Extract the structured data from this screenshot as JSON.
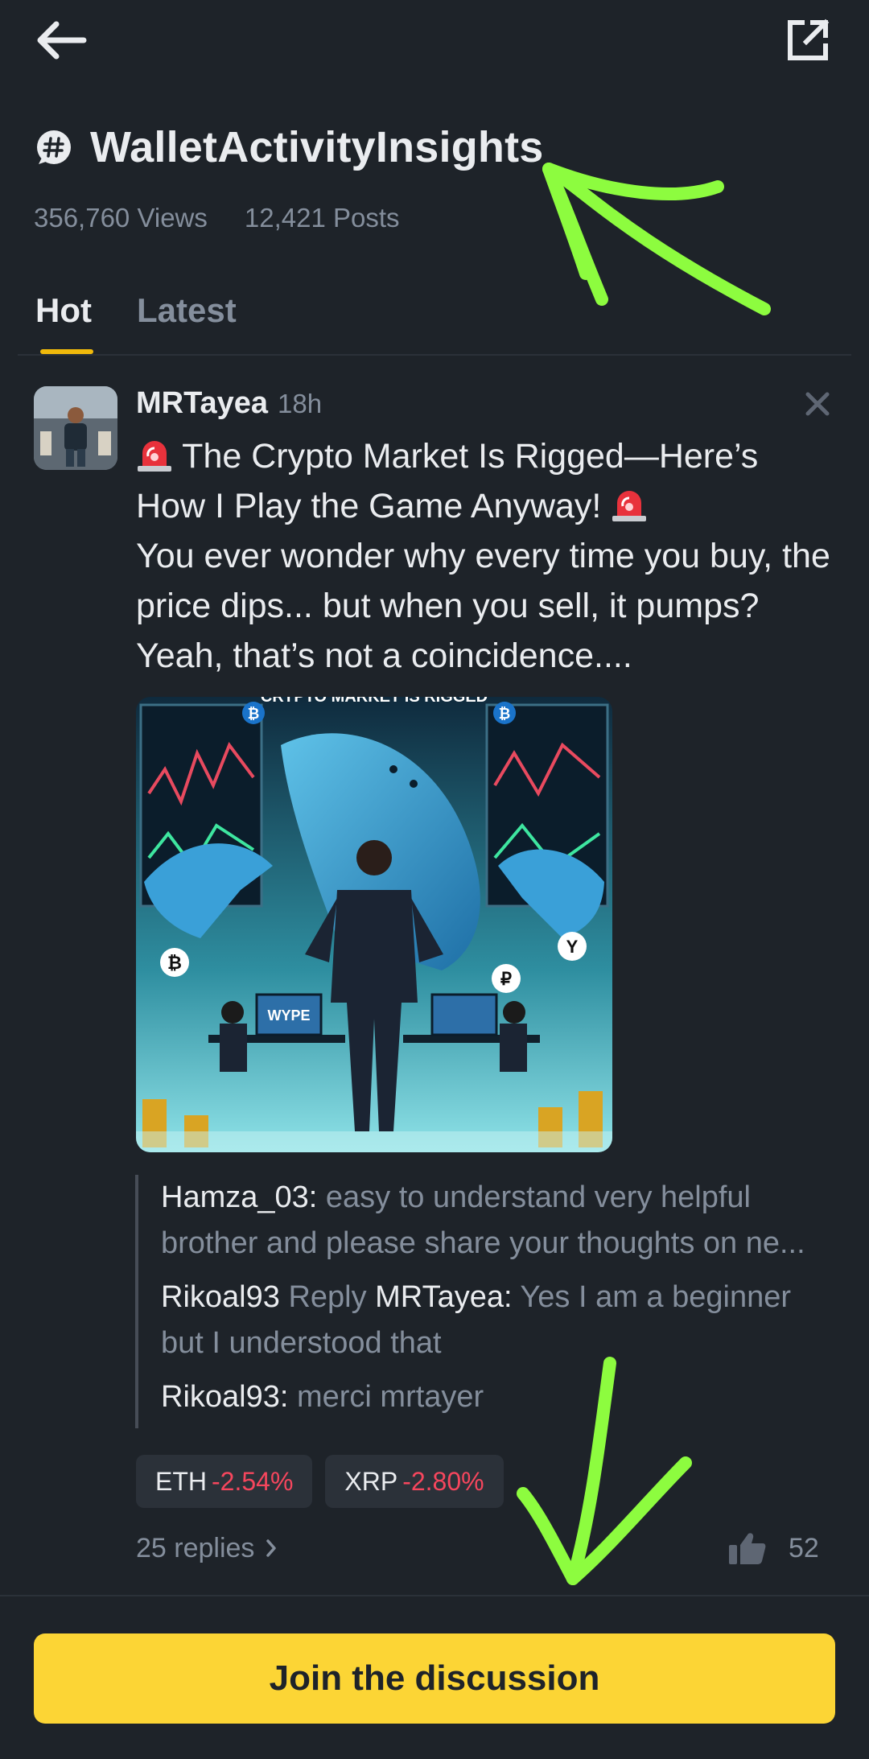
{
  "header": {
    "title": "WalletActivityInsights",
    "views": "356,760 Views",
    "posts": "12,421 Posts"
  },
  "tabs": [
    {
      "label": "Hot",
      "active": true
    },
    {
      "label": "Latest",
      "active": false
    }
  ],
  "post": {
    "author": "MRTayea",
    "time": "18h",
    "headline": "The Crypto Market Is Rigged—Here’s How I Play the Game Anyway!",
    "body": "You ever wonder why every time you buy, the price dips... but when you sell, it pumps? Yeah, that’s not a coincidence....",
    "image_text": {
      "banner": "CRYPTO MARKET IS RIGGED",
      "screen": "WYPE"
    },
    "comments": [
      {
        "name": "Hamza_03:",
        "text": "easy to understand very helpful brother and please share your thoughts on ne..."
      },
      {
        "name": "Rikoal93",
        "reply_label": "Reply",
        "reply_to": "MRTayea:",
        "text": "Yes I am a beginner but I understood that"
      },
      {
        "name": "Rikoal93:",
        "text": "merci mrtayer"
      }
    ],
    "tickers": [
      {
        "symbol": "ETH",
        "change": "-2.54%"
      },
      {
        "symbol": "XRP",
        "change": "-2.80%"
      }
    ],
    "replies": "25 replies",
    "likes": "52"
  },
  "footer": {
    "join_label": "Join the discussion"
  },
  "colors": {
    "background": "#1e2329",
    "accent": "#f0b90b",
    "button": "#fcd535",
    "negative": "#f6465d",
    "annotation": "#8dfc3f"
  },
  "icons": [
    "back-arrow-icon",
    "share-icon",
    "hashtag-icon",
    "siren-icon",
    "close-icon",
    "chevron-right-icon",
    "thumbs-up-icon"
  ]
}
